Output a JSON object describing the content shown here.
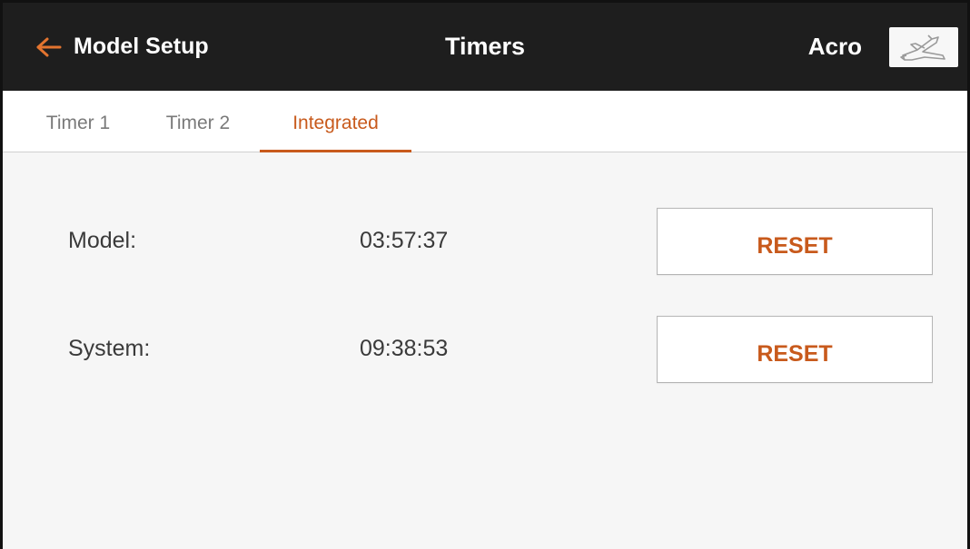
{
  "header": {
    "back_label": "Model Setup",
    "title": "Timers",
    "model_name": "Acro",
    "model_icon": "airplane-icon"
  },
  "tabs": [
    {
      "label": "Timer 1",
      "active": false
    },
    {
      "label": "Timer 2",
      "active": false
    },
    {
      "label": "Integrated",
      "active": true
    }
  ],
  "timers": [
    {
      "label": "Model:",
      "value": "03:57:37",
      "button_label": "RESET"
    },
    {
      "label": "System:",
      "value": "09:38:53",
      "button_label": "RESET"
    }
  ],
  "colors": {
    "accent": "#c85a1c",
    "header_bg": "#1e1e1e",
    "content_bg": "#f6f6f6",
    "text": "#3a3a3a",
    "inactive_tab": "#7a7a7a"
  }
}
